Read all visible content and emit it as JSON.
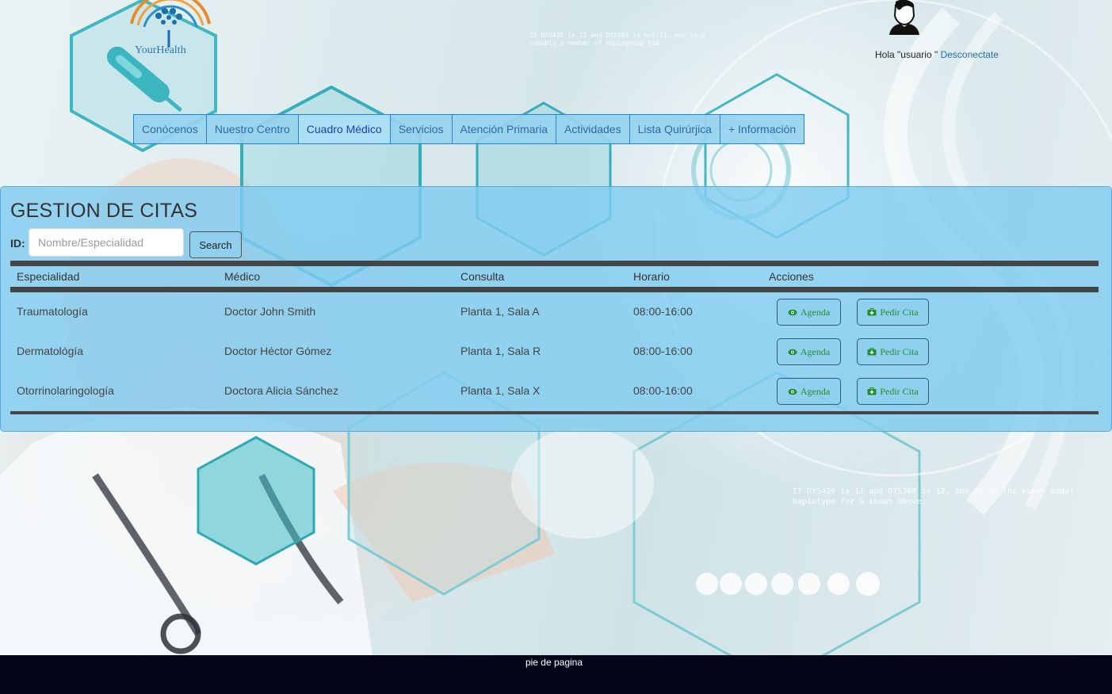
{
  "brand": {
    "name": "YourHealth",
    "icon": "caduceus-tree-logo"
  },
  "user": {
    "greeting": "Hola \"usuario \"",
    "logout_label": "Desconectate",
    "avatar_icon": "user-avatar-icon"
  },
  "nav": {
    "items": [
      {
        "label": "Conócenos"
      },
      {
        "label": "Nuestro Centro"
      },
      {
        "label": "Cuadro Médico",
        "active": true
      },
      {
        "label": "Servicios"
      },
      {
        "label": "Atención Primaria"
      },
      {
        "label": "Actividades"
      },
      {
        "label": "Lista Quirúrjica"
      },
      {
        "label": "+ Información"
      }
    ]
  },
  "main": {
    "title": "GESTION DE CITAS",
    "id_label": "ID:",
    "search_placeholder": "Nombre/Especialidad",
    "search_value": "",
    "search_button": "Search",
    "table": {
      "headers": [
        "Especialidad",
        "Médico",
        "Consulta",
        "Horario",
        "Acciones"
      ],
      "rows": [
        {
          "especialidad": "Traumatología",
          "medico": "Doctor John Smith",
          "consulta": "Planta 1, Sala A",
          "horario": "08:00-16:00"
        },
        {
          "especialidad": "Dermatológía",
          "medico": "Doctor Héctor Gómez",
          "consulta": "Planta 1, Sala R",
          "horario": "08:00-16:00"
        },
        {
          "especialidad": "Otorrinolaringología",
          "medico": "Doctora Alicia Sánchez",
          "consulta": "Planta 1, Sala X",
          "horario": "08:00-16:00"
        }
      ],
      "actions": {
        "agenda_label": "Agenda",
        "agenda_icon": "eye-icon",
        "cita_label": "Pedir Cita",
        "cita_icon": "medical-kit-icon"
      }
    }
  },
  "background": {
    "overlay_text_1": "If DYS426 is 12 and DYS392 is not 11, one is p robably a member of haplogroup R1b.",
    "overlay_text_2": "If DYS426 is 11 and DYS388 is 12, one is in the known modal haplotype for G shown above."
  },
  "footer": {
    "text": "pie de pagina"
  },
  "colors": {
    "panel": "#80ccf0",
    "nav_border": "#2a82c6",
    "action_green": "#1f8f2a",
    "footer_bg": "#05051a",
    "link": "#1e6fb3"
  }
}
